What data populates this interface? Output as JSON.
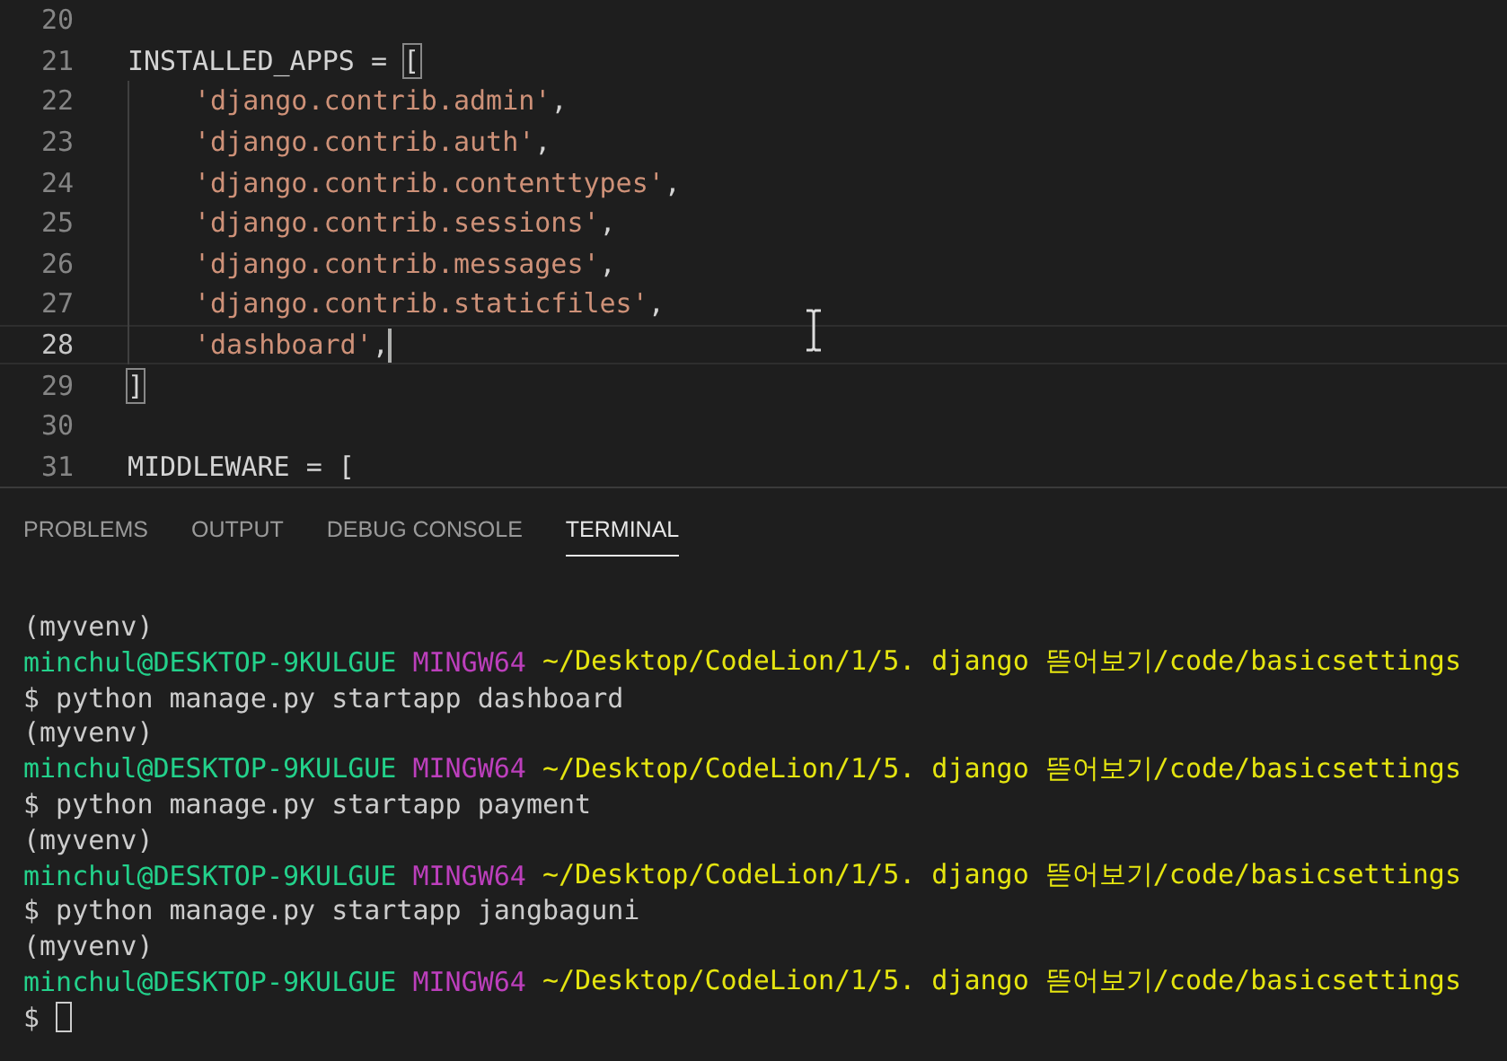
{
  "editor": {
    "lines": [
      {
        "number": "20",
        "current": false,
        "indent": false
      },
      {
        "number": "21",
        "current": false,
        "indent": false,
        "segments": [
          {
            "text": "INSTALLED_APPS = ",
            "kind": "plain"
          },
          {
            "text": "[",
            "kind": "bracket-match"
          }
        ]
      },
      {
        "number": "22",
        "current": false,
        "indent": true,
        "segments": [
          {
            "text": "'django.contrib.admin'",
            "kind": "string"
          },
          {
            "text": ",",
            "kind": "plain"
          }
        ]
      },
      {
        "number": "23",
        "current": false,
        "indent": true,
        "segments": [
          {
            "text": "'django.contrib.auth'",
            "kind": "string"
          },
          {
            "text": ",",
            "kind": "plain"
          }
        ]
      },
      {
        "number": "24",
        "current": false,
        "indent": true,
        "segments": [
          {
            "text": "'django.contrib.contenttypes'",
            "kind": "string"
          },
          {
            "text": ",",
            "kind": "plain"
          }
        ]
      },
      {
        "number": "25",
        "current": false,
        "indent": true,
        "segments": [
          {
            "text": "'django.contrib.sessions'",
            "kind": "string"
          },
          {
            "text": ",",
            "kind": "plain"
          }
        ]
      },
      {
        "number": "26",
        "current": false,
        "indent": true,
        "segments": [
          {
            "text": "'django.contrib.messages'",
            "kind": "string"
          },
          {
            "text": ",",
            "kind": "plain"
          }
        ]
      },
      {
        "number": "27",
        "current": false,
        "indent": true,
        "segments": [
          {
            "text": "'django.contrib.staticfiles'",
            "kind": "string"
          },
          {
            "text": ",",
            "kind": "plain"
          }
        ]
      },
      {
        "number": "28",
        "current": true,
        "indent": true,
        "segments": [
          {
            "text": "'dashboard'",
            "kind": "string"
          },
          {
            "text": ",",
            "kind": "plain"
          }
        ]
      },
      {
        "number": "29",
        "current": false,
        "indent": false,
        "segments": [
          {
            "text": "]",
            "kind": "bracket-match"
          }
        ]
      },
      {
        "number": "30",
        "current": false,
        "indent": false
      },
      {
        "number": "31",
        "current": false,
        "indent": false,
        "segments": [
          {
            "text": "MIDDLEWARE = [",
            "kind": "plain"
          }
        ]
      }
    ]
  },
  "panel": {
    "tabs": [
      {
        "label": "PROBLEMS",
        "selected": false
      },
      {
        "label": "OUTPUT",
        "selected": false
      },
      {
        "label": "DEBUG CONSOLE",
        "selected": false
      },
      {
        "label": "TERMINAL",
        "selected": true
      }
    ]
  },
  "terminal": {
    "lines": [
      {
        "kind": "venv",
        "text": "(myvenv)"
      },
      {
        "kind": "prompt",
        "user": "minchul@DESKTOP-9KULGUE",
        "shell": "MINGW64",
        "path": "~/Desktop/CodeLion/1/5. django 뜯어보기/code/basicsettings"
      },
      {
        "kind": "command",
        "text": "$ python manage.py startapp dashboard"
      },
      {
        "kind": "venv",
        "text": "(myvenv)"
      },
      {
        "kind": "prompt",
        "user": "minchul@DESKTOP-9KULGUE",
        "shell": "MINGW64",
        "path": "~/Desktop/CodeLion/1/5. django 뜯어보기/code/basicsettings"
      },
      {
        "kind": "command",
        "text": "$ python manage.py startapp payment"
      },
      {
        "kind": "venv",
        "text": "(myvenv)"
      },
      {
        "kind": "prompt",
        "user": "minchul@DESKTOP-9KULGUE",
        "shell": "MINGW64",
        "path": "~/Desktop/CodeLion/1/5. django 뜯어보기/code/basicsettings"
      },
      {
        "kind": "command",
        "text": "$ python manage.py startapp jangbaguni"
      },
      {
        "kind": "venv",
        "text": "(myvenv)"
      },
      {
        "kind": "prompt",
        "user": "minchul@DESKTOP-9KULGUE",
        "shell": "MINGW64",
        "path": "~/Desktop/CodeLion/1/5. django 뜯어보기/code/basicsettings"
      },
      {
        "kind": "input",
        "text": "$"
      }
    ]
  }
}
